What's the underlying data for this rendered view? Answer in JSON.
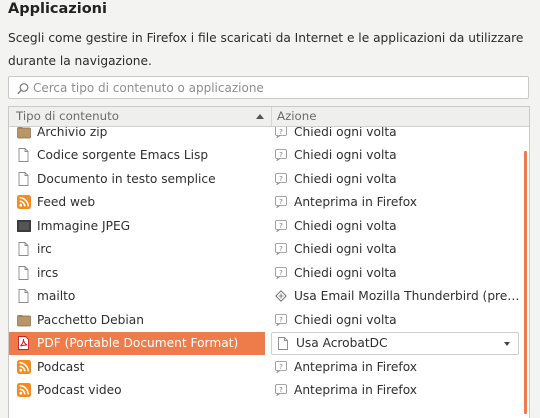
{
  "section": {
    "title": "Applicazioni",
    "description": "Scegli come gestire in Firefox i file scaricati da Internet e le applicazioni da utilizzare durante la navigazione."
  },
  "search": {
    "placeholder": "Cerca tipo di contenuto o applicazione"
  },
  "table": {
    "col_type": "Tipo di contenuto",
    "col_action": "Azione",
    "rows": [
      {
        "type": "Archivio zip",
        "action": "Chiedi ogni volta",
        "icon": "folder-icon",
        "action_icon": "ask-icon"
      },
      {
        "type": "Codice sorgente Emacs Lisp",
        "action": "Chiedi ogni volta",
        "icon": "file-icon",
        "action_icon": "ask-icon"
      },
      {
        "type": "Documento in testo semplice",
        "action": "Chiedi ogni volta",
        "icon": "file-icon",
        "action_icon": "ask-icon"
      },
      {
        "type": "Feed web",
        "action": "Anteprima in Firefox",
        "icon": "feed-icon",
        "action_icon": "preview-icon"
      },
      {
        "type": "Immagine JPEG",
        "action": "Chiedi ogni volta",
        "icon": "image-icon",
        "action_icon": "ask-icon"
      },
      {
        "type": "irc",
        "action": "Chiedi ogni volta",
        "icon": "file-icon",
        "action_icon": "ask-icon"
      },
      {
        "type": "ircs",
        "action": "Chiedi ogni volta",
        "icon": "file-icon",
        "action_icon": "ask-icon"
      },
      {
        "type": "mailto",
        "action": "Usa Email Mozilla Thunderbird (predefinito)",
        "icon": "file-icon",
        "action_icon": "thunderbird-icon"
      },
      {
        "type": "Pacchetto Debian",
        "action": "Chiedi ogni volta",
        "icon": "folder-icon",
        "action_icon": "ask-icon"
      },
      {
        "type": "PDF (Portable Document Format)",
        "action": "Usa AcrobatDC",
        "icon": "pdf-icon",
        "action_icon": "app-icon",
        "selected": true
      },
      {
        "type": "Podcast",
        "action": "Anteprima in Firefox",
        "icon": "feed-icon",
        "action_icon": "preview-icon"
      },
      {
        "type": "Podcast video",
        "action": "Anteprima in Firefox",
        "icon": "feed-icon",
        "action_icon": "preview-icon"
      }
    ]
  },
  "colors": {
    "accent": "#ee7c4a",
    "feed": "#f28c1e"
  }
}
